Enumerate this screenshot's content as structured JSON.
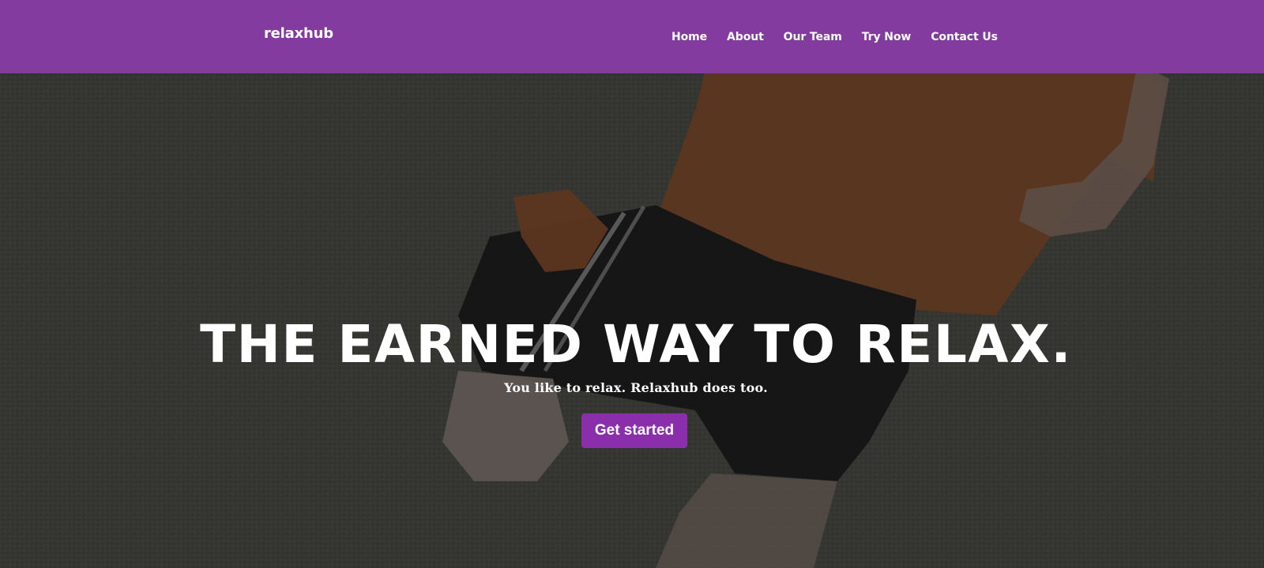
{
  "nav": {
    "brand": "relaxhub",
    "links": [
      "Home",
      "About",
      "Our Team",
      "Try Now",
      "Contact Us"
    ]
  },
  "hero": {
    "headline": "THE EARNED WAY TO RELAX.",
    "subtitle": "You like to relax. Relaxhub does too.",
    "cta_label": "Get started"
  },
  "colors": {
    "nav_background": "#833b9f",
    "cta_background": "#8a2eab",
    "text": "#ffffff",
    "hero_overlay": "#3a3b36"
  }
}
